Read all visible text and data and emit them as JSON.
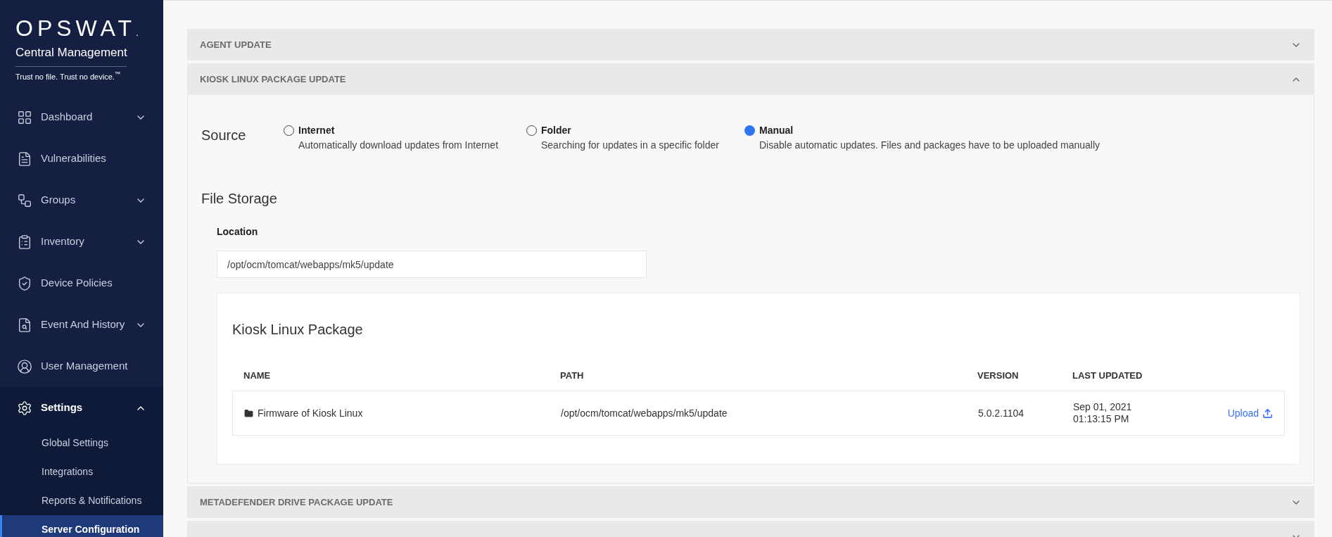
{
  "sidebar": {
    "logo": "OPSWAT",
    "logo_mark": ".",
    "product": "Central Management",
    "tagline": "Trust no file. Trust no device.",
    "tagline_mark": "™",
    "items": [
      {
        "kind": "dashboard",
        "label": "Dashboard",
        "expanded": false
      },
      {
        "kind": "vulnerabilities",
        "label": "Vulnerabilities"
      },
      {
        "kind": "groups",
        "label": "Groups",
        "expanded": false
      },
      {
        "kind": "inventory",
        "label": "Inventory",
        "expanded": false
      },
      {
        "kind": "policies",
        "label": "Device Policies"
      },
      {
        "kind": "events",
        "label": "Event And History",
        "expanded": false
      },
      {
        "kind": "users",
        "label": "User Management"
      },
      {
        "kind": "settings",
        "label": "Settings",
        "expanded": true,
        "children": [
          {
            "label": "Global Settings",
            "selected": false
          },
          {
            "label": "Integrations",
            "selected": false
          },
          {
            "label": "Reports & Notifications",
            "selected": false
          },
          {
            "label": "Server Configuration",
            "selected": true
          }
        ]
      }
    ]
  },
  "sections": [
    {
      "title": "AGENT UPDATE",
      "expanded": false
    },
    {
      "title": "KIOSK LINUX PACKAGE UPDATE",
      "expanded": true,
      "content": {
        "source_label": "Source",
        "options": [
          {
            "label": "Internet",
            "description": "Automatically download updates from Internet",
            "selected": false
          },
          {
            "label": "Folder",
            "description": "Searching for updates in a specific folder",
            "selected": false
          },
          {
            "label": "Manual",
            "description": "Disable automatic updates. Files and packages have to be uploaded manually",
            "selected": true
          }
        ],
        "storage_title": "File Storage",
        "location_label": "Location",
        "location_value": "/opt/ocm/tomcat/webapps/mk5/update",
        "package": {
          "title": "Kiosk Linux Package",
          "columns": [
            "NAME",
            "PATH",
            "VERSION",
            "LAST UPDATED"
          ],
          "rows": [
            {
              "name": "Firmware of Kiosk Linux",
              "path": "/opt/ocm/tomcat/webapps/mk5/update",
              "version": "5.0.2.1104",
              "last_updated": [
                "Sep 01, 2021",
                "01:13:15 PM"
              ],
              "action": "Upload"
            }
          ]
        }
      }
    },
    {
      "title": "METADEFENDER DRIVE PACKAGE UPDATE",
      "expanded": false
    },
    {
      "expanded": false
    }
  ]
}
